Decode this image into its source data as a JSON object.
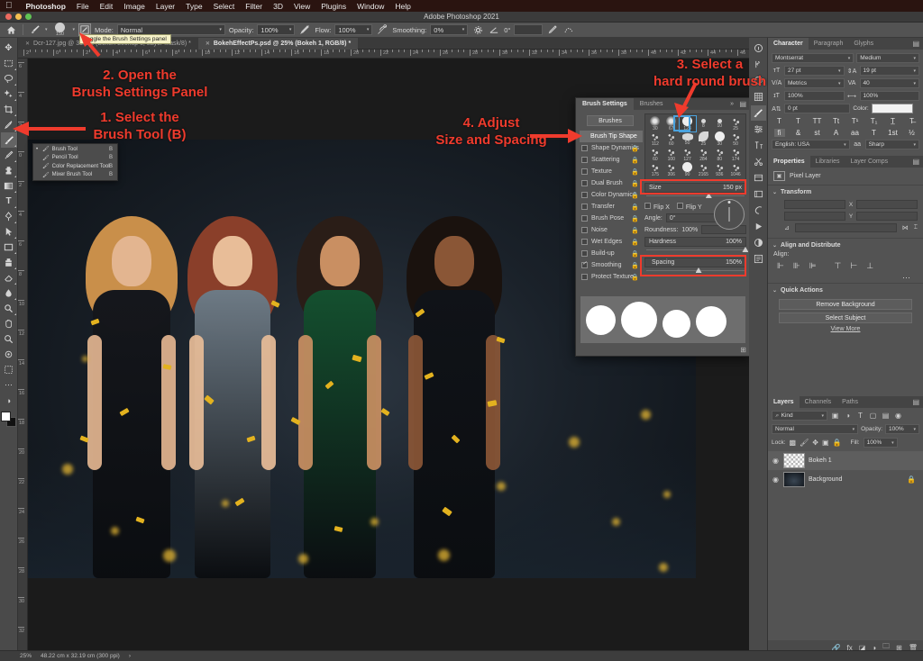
{
  "mac_menu": {
    "apple": "apple-logo",
    "items": [
      "Photoshop",
      "File",
      "Edit",
      "Image",
      "Layer",
      "Type",
      "Select",
      "Filter",
      "3D",
      "View",
      "Plugins",
      "Window",
      "Help"
    ]
  },
  "window": {
    "title": "Adobe Photoshop 2021"
  },
  "options_bar": {
    "home_icon": "home-icon",
    "tool_icon": "brush-tool-icon",
    "brush_size_label": "150",
    "toggle_panel_icon": "toggle-brush-settings-icon",
    "mode_label": "Mode:",
    "mode_value": "Normal",
    "opacity_label": "Opacity:",
    "opacity_value": "100%",
    "pressure_opacity_icon": "pressure-opacity-icon",
    "flow_label": "Flow:",
    "flow_value": "100%",
    "airbrush_icon": "airbrush-icon",
    "smoothing_label": "Smoothing:",
    "smoothing_value": "0%",
    "smoothing_options_icon": "gear-icon",
    "angle_label": "",
    "angle_value": "0°",
    "symmetry_icon": "symmetry-icon",
    "tablet_pressure_icon": "tablet-pressure-icon"
  },
  "tooltip": {
    "text": "Toggle the Brush Settings panel"
  },
  "tabs": [
    {
      "label": "Dcr-127.jpg @ 33.3% (Bokeh Lookup 1, Layer Mask/8) *",
      "active": false
    },
    {
      "label": "BokehEffectPs.psd @ 25% (Bokeh 1, RGB/8) *",
      "active": true
    }
  ],
  "toolbar": {
    "tools": [
      {
        "name": "move-tool",
        "glyph": "✥"
      },
      {
        "name": "rectangular-marquee-tool",
        "glyph": "▭"
      },
      {
        "name": "lasso-tool",
        "glyph": "◯"
      },
      {
        "name": "object-selection-tool",
        "glyph": "✦"
      },
      {
        "name": "crop-tool",
        "glyph": "⌗"
      },
      {
        "name": "eyedropper-tool",
        "glyph": "⌇"
      },
      {
        "name": "brush-tool",
        "glyph": "🖌",
        "selected": true
      },
      {
        "name": "spot-healing-brush-tool",
        "glyph": "✧"
      },
      {
        "name": "clone-stamp-tool",
        "glyph": "⎙"
      },
      {
        "name": "gradient-tool",
        "glyph": "◧"
      },
      {
        "name": "type-tool",
        "glyph": "T"
      },
      {
        "name": "pen-tool",
        "glyph": "✑"
      },
      {
        "name": "path-selection-tool",
        "glyph": "↖"
      },
      {
        "name": "shape-tool",
        "glyph": "▢"
      },
      {
        "name": "stamp-tool",
        "glyph": "♜"
      },
      {
        "name": "eraser-tool",
        "glyph": "◪"
      },
      {
        "name": "blur-tool",
        "glyph": "💧"
      },
      {
        "name": "dodge-tool",
        "glyph": "◐"
      },
      {
        "name": "hand-tool",
        "glyph": "✋"
      },
      {
        "name": "zoom-tool",
        "glyph": "⌕"
      },
      {
        "name": "custom-tool",
        "glyph": "❂"
      },
      {
        "name": "edit-toolbar",
        "glyph": "⬚"
      },
      {
        "name": "more-tools",
        "glyph": "⋯"
      },
      {
        "name": "quick-mask",
        "glyph": "◑"
      }
    ],
    "foreground_color": "#ffffff",
    "background_color": "#111111"
  },
  "tool_flyout": {
    "items": [
      {
        "label": "Brush Tool",
        "shortcut": "B",
        "icon": "brush-icon",
        "active": true
      },
      {
        "label": "Pencil Tool",
        "shortcut": "B",
        "icon": "pencil-icon",
        "active": false
      },
      {
        "label": "Color Replacement Tool",
        "shortcut": "B",
        "icon": "color-replacement-icon",
        "active": false
      },
      {
        "label": "Mixer Brush Tool",
        "shortcut": "B",
        "icon": "mixer-brush-icon",
        "active": false
      }
    ]
  },
  "ruler": {
    "h_labels": [
      "2",
      "0",
      "2",
      "4",
      "6",
      "8",
      "10",
      "12",
      "14",
      "16",
      "18",
      "20",
      "22",
      "24",
      "26",
      "28",
      "30",
      "32",
      "34",
      "36",
      "38",
      "40",
      "42",
      "44",
      "46",
      "48"
    ],
    "v_labels": [
      "6",
      "4",
      "2",
      "0",
      "2",
      "4",
      "6",
      "8",
      "10",
      "12",
      "14",
      "16",
      "18",
      "20",
      "22",
      "24",
      "26",
      "28",
      "30",
      "32"
    ]
  },
  "brush_settings": {
    "tabs": [
      {
        "label": "Brush Settings",
        "active": true
      },
      {
        "label": "Brushes",
        "active": false
      }
    ],
    "brushes_button": "Brushes",
    "options": [
      {
        "label": "Brush Tip Shape",
        "checkbox": false,
        "highlight": true,
        "lock": false
      },
      {
        "label": "Shape Dynamics",
        "checkbox": false,
        "highlight": false,
        "lock": true
      },
      {
        "label": "Scattering",
        "checkbox": false,
        "highlight": false,
        "lock": true
      },
      {
        "label": "Texture",
        "checkbox": false,
        "highlight": false,
        "lock": true
      },
      {
        "label": "Dual Brush",
        "checkbox": false,
        "highlight": false,
        "lock": true
      },
      {
        "label": "Color Dynamics",
        "checkbox": false,
        "highlight": false,
        "lock": true
      },
      {
        "label": "Transfer",
        "checkbox": false,
        "highlight": false,
        "lock": true
      },
      {
        "label": "Brush Pose",
        "checkbox": false,
        "highlight": false,
        "lock": true
      },
      {
        "label": "Noise",
        "checkbox": false,
        "highlight": false,
        "lock": true
      },
      {
        "label": "Wet Edges",
        "checkbox": false,
        "highlight": false,
        "lock": true
      },
      {
        "label": "Build-up",
        "checkbox": false,
        "highlight": false,
        "lock": true
      },
      {
        "label": "Smoothing",
        "checkbox": true,
        "highlight": false,
        "lock": true
      },
      {
        "label": "Protect Texture",
        "checkbox": false,
        "highlight": false,
        "lock": true
      }
    ],
    "brush_grid": [
      {
        "size": "30",
        "selected": false
      },
      {
        "size": "67",
        "selected": false
      },
      {
        "size": "123",
        "selected": true
      },
      {
        "size": "8",
        "selected": false
      },
      {
        "size": "10",
        "selected": false
      },
      {
        "size": "25",
        "selected": false
      },
      {
        "size": "112",
        "selected": false
      },
      {
        "size": "60",
        "selected": false
      },
      {
        "size": "50",
        "selected": false
      },
      {
        "size": "25",
        "selected": false
      },
      {
        "size": "30",
        "selected": false
      },
      {
        "size": "50",
        "selected": false
      },
      {
        "size": "60",
        "selected": false
      },
      {
        "size": "100",
        "selected": false
      },
      {
        "size": "127",
        "selected": false
      },
      {
        "size": "284",
        "selected": false
      },
      {
        "size": "80",
        "selected": false
      },
      {
        "size": "174",
        "selected": false
      },
      {
        "size": "175",
        "selected": false
      },
      {
        "size": "306",
        "selected": false
      },
      {
        "size": "90",
        "selected": false
      },
      {
        "size": "2165",
        "selected": false
      },
      {
        "size": "936",
        "selected": false
      },
      {
        "size": "1046",
        "selected": false
      }
    ],
    "size_label": "Size",
    "size_value": "150 px",
    "flip_x_label": "Flip X",
    "flip_y_label": "Flip Y",
    "angle_label": "Angle:",
    "angle_value": "0°",
    "roundness_label": "Roundness:",
    "roundness_value": "100%",
    "hardness_label": "Hardness",
    "hardness_value": "100%",
    "spacing_label": "Spacing",
    "spacing_value": "150%",
    "spacing_checked": true,
    "new_brush_icon": "new-brush-icon"
  },
  "dock_icons": [
    {
      "name": "info-icon",
      "glyph": "ⓘ",
      "selected": false
    },
    {
      "name": "history-icon",
      "glyph": "⎘",
      "selected": false
    },
    {
      "name": "color-icon",
      "glyph": "◕",
      "selected": false
    },
    {
      "name": "swatches-grid-icon",
      "glyph": "▦",
      "selected": false
    },
    {
      "name": "brush-settings-icon",
      "glyph": "🖌",
      "selected": true
    },
    {
      "name": "adjustments-icon",
      "glyph": "⚏",
      "selected": false
    },
    {
      "name": "character-styles-icon",
      "glyph": "⫼",
      "selected": false
    },
    {
      "name": "actions-icon",
      "glyph": "✂",
      "selected": false
    },
    {
      "name": "swatches-icon",
      "glyph": "▤",
      "selected": false
    },
    {
      "name": "patterns-icon",
      "glyph": "▥",
      "selected": false
    },
    {
      "name": "gradients-icon",
      "glyph": "◕",
      "selected": false
    },
    {
      "name": "timeline-icon",
      "glyph": "▶",
      "selected": false
    },
    {
      "name": "adjustment-layer-icon",
      "glyph": "◑",
      "selected": false
    },
    {
      "name": "notes-icon",
      "glyph": "▨",
      "selected": false
    }
  ],
  "character_panel": {
    "tabs": [
      {
        "label": "Character",
        "active": true
      },
      {
        "label": "Paragraph",
        "active": false
      },
      {
        "label": "Glyphs",
        "active": false
      }
    ],
    "font_family": "Montserrat",
    "font_style": "Medium",
    "font_size": "27 pt",
    "leading": "19 pt",
    "kerning": "Metrics",
    "tracking": "40",
    "vertical_scale": "100%",
    "horizontal_scale": "100%",
    "baseline_shift": "0 pt",
    "color_label": "Color:",
    "color_value": "#f2f2f2",
    "style_buttons": [
      "T",
      "T",
      "TT",
      "Tt",
      "T¹",
      "T₁",
      "T̲",
      "T̶"
    ],
    "style_buttons2": [
      "fi",
      "&",
      "st",
      "A",
      "aa",
      "T",
      "1st",
      "½"
    ],
    "language": "English: USA",
    "antialias": "Sharp"
  },
  "properties_panel": {
    "tabs": [
      {
        "label": "Properties",
        "active": true
      },
      {
        "label": "Libraries",
        "active": false
      },
      {
        "label": "Layer Comps",
        "active": false
      }
    ],
    "layer_type": "Pixel Layer",
    "layer_type_icon": "image-icon",
    "transform_header": "Transform",
    "align_header": "Align and Distribute",
    "align_label": "Align:",
    "quick_actions_header": "Quick Actions",
    "remove_background": "Remove Background",
    "select_subject": "Select Subject",
    "view_more": "View More"
  },
  "layers_panel": {
    "tabs": [
      {
        "label": "Layers",
        "active": true
      },
      {
        "label": "Channels",
        "active": false
      },
      {
        "label": "Paths",
        "active": false
      }
    ],
    "filter_label": "Kind",
    "filter_icon": "search-icon",
    "blend_mode": "Normal",
    "opacity_label": "Opacity:",
    "opacity_value": "100%",
    "lock_label": "Lock:",
    "fill_label": "Fill:",
    "fill_value": "100%",
    "layers": [
      {
        "name": "Bokeh 1",
        "visible": true,
        "selected": true,
        "thumb": "checker",
        "locked": false
      },
      {
        "name": "Background",
        "visible": true,
        "selected": false,
        "thumb": "photo",
        "locked": true
      }
    ],
    "footer_icons": [
      "link-icon",
      "fx-icon",
      "mask-icon",
      "adjustment-icon",
      "group-icon",
      "new-layer-icon",
      "delete-icon"
    ]
  },
  "status_bar": {
    "zoom": "25%",
    "doc_size": "48.22 cm x 32.19 cm (300 ppi)",
    "arrow_icon": "chevron-right-icon"
  },
  "annotations": [
    {
      "id": "anno1",
      "text": "1. Select the\nBrush Tool (B)"
    },
    {
      "id": "anno2",
      "text": "2. Open the\nBrush Settings Panel"
    },
    {
      "id": "anno3",
      "text": "3. Select a\nhard round brush"
    },
    {
      "id": "anno4",
      "text": "4. Adjust\nSize and Spacing"
    }
  ],
  "colors": {
    "annotation_red": "#ef3b2d",
    "selection_blue": "#4aa3df",
    "panel_bg": "#535353",
    "app_bg": "#3c3c3c"
  }
}
